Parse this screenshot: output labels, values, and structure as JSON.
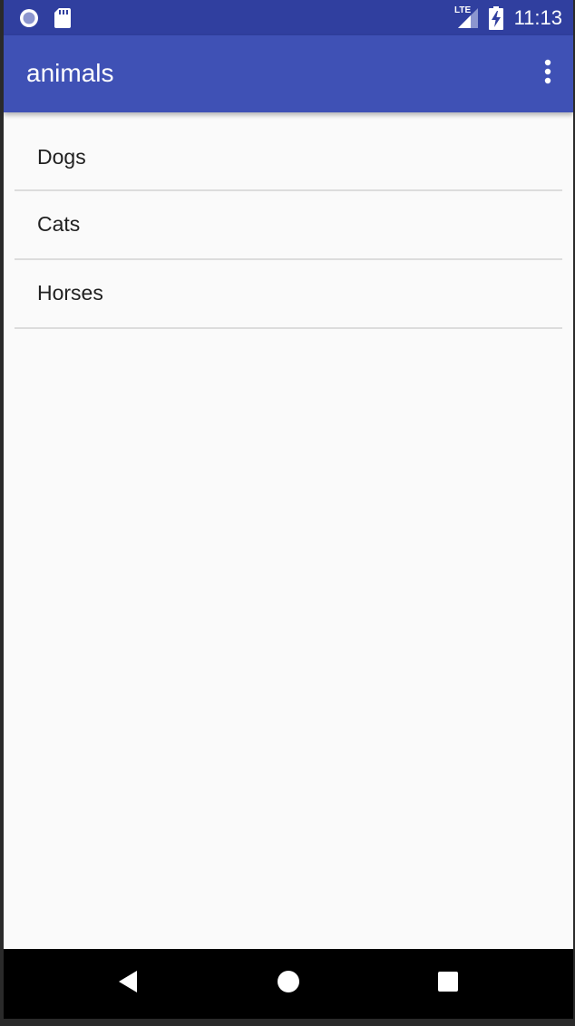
{
  "status_bar": {
    "time": "11:13",
    "left_icons": [
      "record-circle-icon",
      "sd-card-icon"
    ],
    "right_icons": [
      "lte-signal-icon",
      "battery-charging-icon"
    ],
    "network_label": "LTE"
  },
  "app_bar": {
    "title": "animals",
    "background": "#3f51b5",
    "status_background": "#303f9f",
    "menu_icon": "more-vert-icon"
  },
  "list": {
    "items": [
      {
        "label": "Dogs"
      },
      {
        "label": "Cats"
      },
      {
        "label": "Horses"
      }
    ]
  },
  "nav_bar": {
    "buttons": [
      "back-icon",
      "home-icon",
      "recents-icon"
    ]
  }
}
